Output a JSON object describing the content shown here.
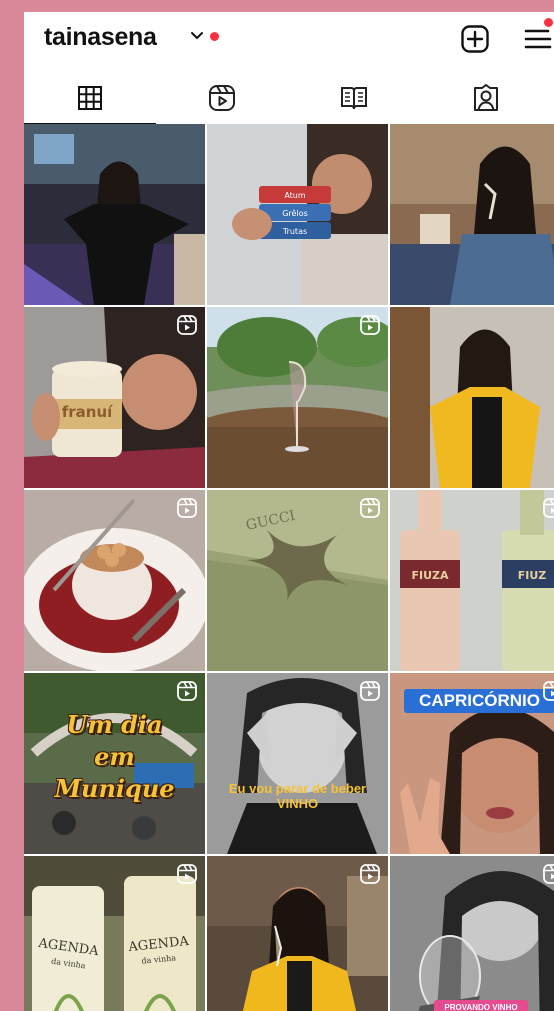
{
  "header": {
    "username": "tainasena"
  },
  "tabs": [
    {
      "name": "tab-posts",
      "icon": "grid-icon",
      "active": true
    },
    {
      "name": "tab-reels",
      "icon": "reels-icon",
      "active": false
    },
    {
      "name": "tab-guides",
      "icon": "guide-book-icon",
      "active": false
    },
    {
      "name": "tab-tagged",
      "icon": "tagged-person-icon",
      "active": false
    }
  ],
  "posts": [
    {
      "id": 1,
      "reel": false,
      "caption": ""
    },
    {
      "id": 2,
      "reel": false,
      "caption": "",
      "label": "Atum / Grêlos / Trutas"
    },
    {
      "id": 3,
      "reel": false,
      "caption": ""
    },
    {
      "id": 4,
      "reel": true,
      "caption": "",
      "brand": "franuí"
    },
    {
      "id": 5,
      "reel": true,
      "caption": ""
    },
    {
      "id": 6,
      "reel": false,
      "caption": ""
    },
    {
      "id": 7,
      "reel": true,
      "caption": ""
    },
    {
      "id": 8,
      "reel": true,
      "caption": "",
      "brand": "GUCCI"
    },
    {
      "id": 9,
      "reel": true,
      "caption": "",
      "brand": "FIUZA",
      "brand2": "FIUZ"
    },
    {
      "id": 10,
      "reel": true,
      "caption": "Um dia\nem\nMunique"
    },
    {
      "id": 11,
      "reel": true,
      "caption": "Eu vou parar de beber\nVINHO"
    },
    {
      "id": 12,
      "reel": true,
      "caption": "CAPRICÓRNIO"
    },
    {
      "id": 13,
      "reel": true,
      "caption": "",
      "brand": "AGENDA",
      "brand2": "da vinha"
    },
    {
      "id": 14,
      "reel": true,
      "caption": ""
    },
    {
      "id": 15,
      "reel": true,
      "caption": "PROVANDO VINHO\nSEM ÁLCOOL"
    }
  ],
  "colors": {
    "notification": "#ff3040",
    "page_bg": "#d9899a"
  }
}
